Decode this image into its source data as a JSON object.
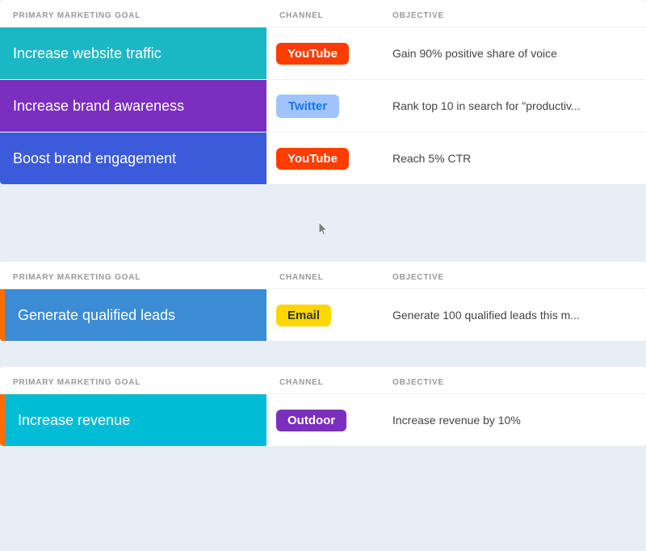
{
  "sections": [
    {
      "id": "section1",
      "rows": [
        {
          "goal": "Increase website traffic",
          "goalColor": "teal",
          "accent": null,
          "channel": "YouTube",
          "channelBadge": "badge-youtube",
          "objective": "Gain 90% positive share of voice"
        },
        {
          "goal": "Increase brand awareness",
          "goalColor": "purple",
          "accent": null,
          "channel": "Twitter",
          "channelBadge": "badge-twitter",
          "objective": "Rank top 10 in search for \"productiv..."
        },
        {
          "goal": "Boost brand engagement",
          "goalColor": "blue",
          "accent": null,
          "channel": "YouTube",
          "channelBadge": "badge-youtube",
          "objective": "Reach 5% CTR"
        }
      ]
    },
    {
      "id": "section2",
      "rows": [
        {
          "goal": "Generate qualified leads",
          "goalColor": "blue2",
          "accent": "accent-orange",
          "channel": "Email",
          "channelBadge": "badge-email",
          "objective": "Generate 100 qualified leads this m..."
        }
      ]
    },
    {
      "id": "section3",
      "rows": [
        {
          "goal": "Increase revenue",
          "goalColor": "cyan",
          "accent": "accent-orange",
          "channel": "Outdoor",
          "channelBadge": "badge-outdoor",
          "objective": "Increase revenue by 10%"
        }
      ]
    }
  ],
  "headers": {
    "goal": "PRIMARY MARKETING GOAL",
    "channel": "CHANNEL",
    "objective": "OBJECTIVE"
  }
}
